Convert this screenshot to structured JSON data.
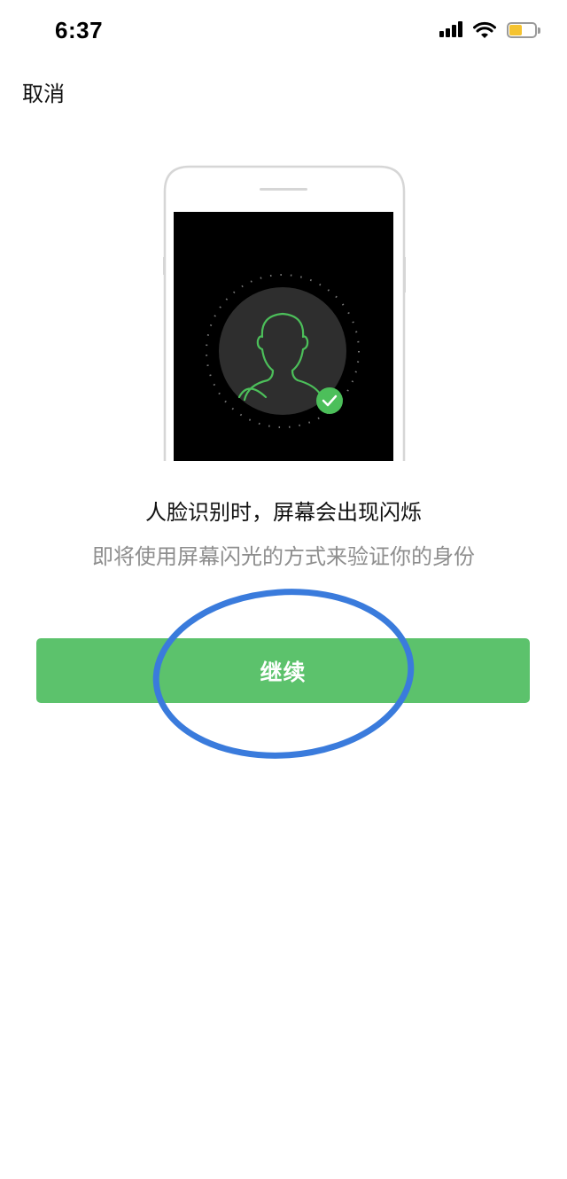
{
  "status_bar": {
    "time": "6:37",
    "icons": [
      "signal-icon",
      "wifi-icon",
      "battery-icon"
    ],
    "battery_color": "#f5c330"
  },
  "nav": {
    "cancel_label": "取消"
  },
  "illustration": {
    "description_icon": "face-scan-icon",
    "accent_color": "#5cc26c"
  },
  "content": {
    "title": "人脸识别时，屏幕会出现闪烁",
    "subtitle": "即将使用屏幕闪光的方式来验证你的身份"
  },
  "actions": {
    "continue_label": "继续",
    "continue_color": "#5cc26c"
  },
  "annotation": {
    "highlight_color": "#3a7bdc"
  }
}
